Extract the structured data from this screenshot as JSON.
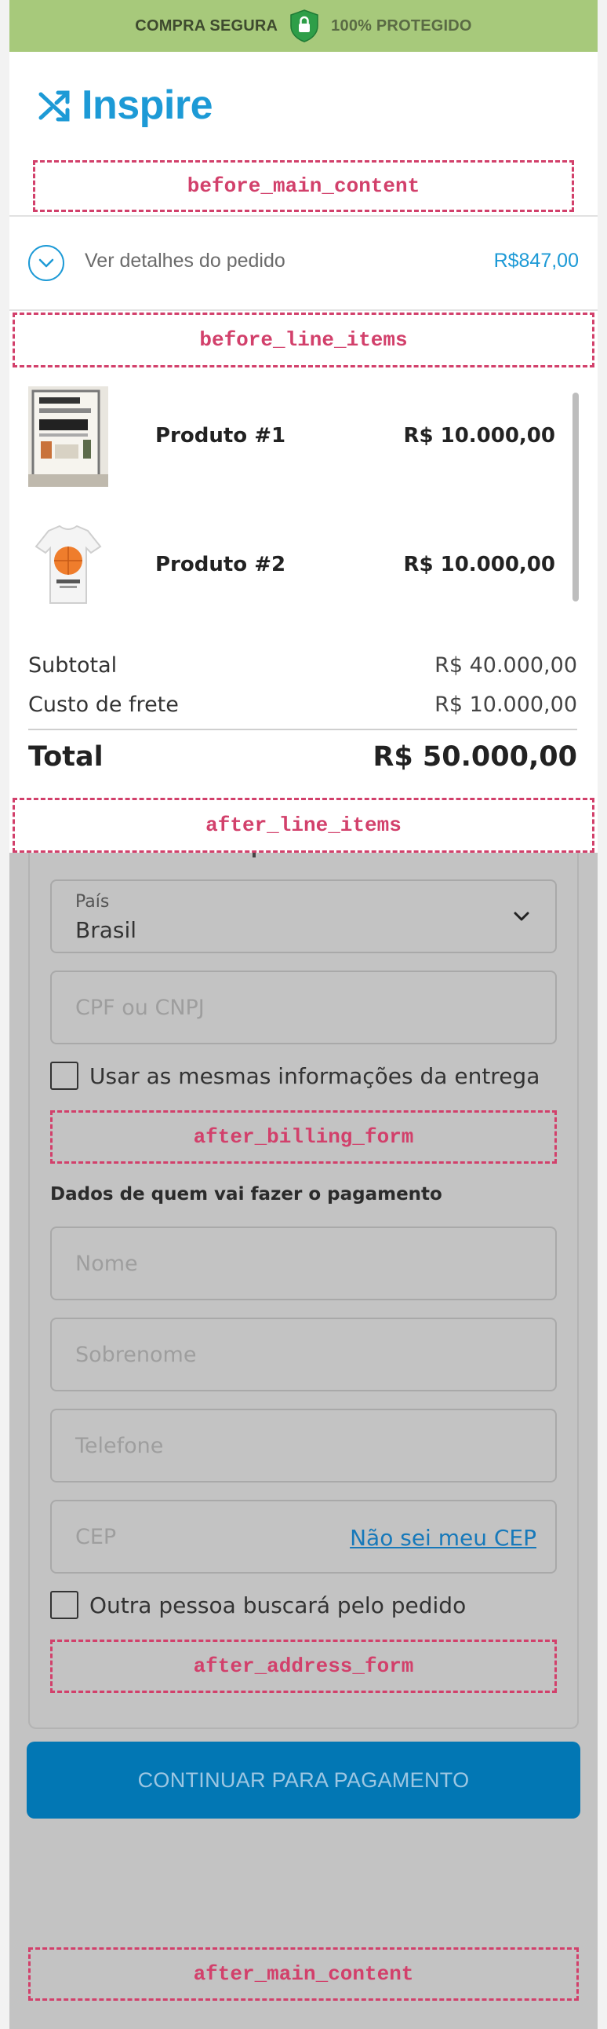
{
  "secure_bar": {
    "left_label": "COMPRA SEGURA",
    "right_label": "100% PROTEGIDO",
    "bar_color": "#a7c97b",
    "icon": "lock-shield-icon"
  },
  "header": {
    "logo_text": "Inspire",
    "logo_icon": "shuffle-icon",
    "brand_color": "#1d9ad6"
  },
  "hooks": {
    "before_main_content": "before_main_content",
    "before_line_items": "before_line_items",
    "after_line_items": "after_line_items",
    "after_billing_form": "after_billing_form",
    "after_address_form": "after_address_form",
    "after_main_content": "after_main_content"
  },
  "order_summary": {
    "toggle_label": "Ver detalhes do pedido",
    "toggle_icon": "chevron-down-icon",
    "price": "R$847,00"
  },
  "line_items": [
    {
      "name": "Produto #1",
      "price": "R$ 10.000,00",
      "thumbnail": "poster-product-image"
    },
    {
      "name": "Produto #2",
      "price": "R$ 10.000,00",
      "thumbnail": "tshirt-product-image"
    }
  ],
  "totals": {
    "subtotal_label": "Subtotal",
    "subtotal_value": "R$ 40.000,00",
    "shipping_label": "Custo de frete",
    "shipping_value": "R$ 10.000,00",
    "total_label": "Total",
    "total_value": "R$ 50.000,00"
  },
  "billing_form": {
    "country_label": "País",
    "country_value": "Brasil",
    "document_placeholder": "CPF ou CNPJ",
    "same_info_label": "Usar as mesmas informações da entrega"
  },
  "payer_section": {
    "title": "Dados de quem vai fazer o pagamento",
    "first_name_placeholder": "Nome",
    "last_name_placeholder": "Sobrenome",
    "phone_placeholder": "Telefone",
    "zip_placeholder": "CEP",
    "zip_help_link": "Não sei meu CEP",
    "pickup_label": "Outra pessoa buscará pelo pedido"
  },
  "actions": {
    "continue_label": "CONTINUAR PARA PAGAMENTO",
    "button_color": "#0277b4"
  }
}
